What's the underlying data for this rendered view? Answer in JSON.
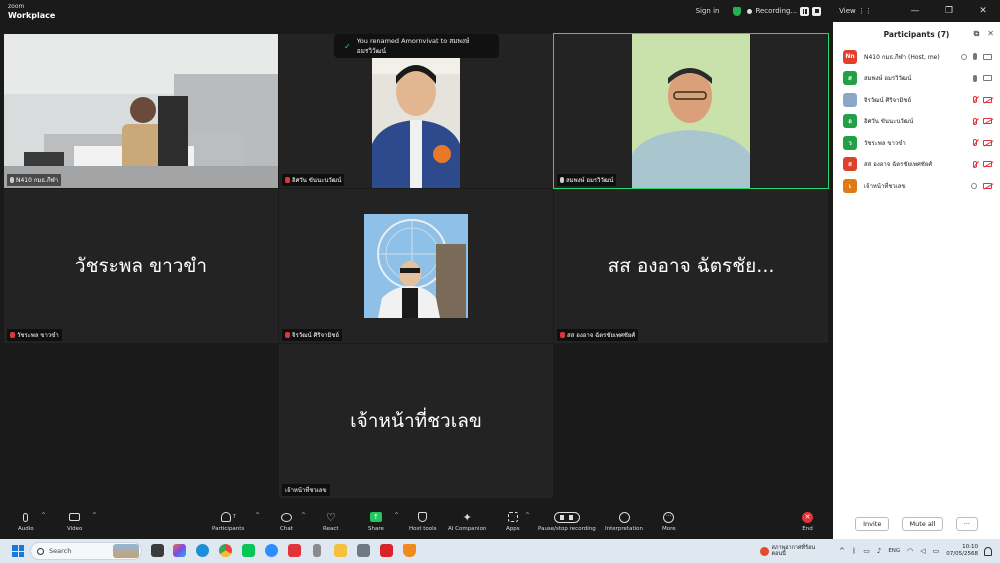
{
  "app": {
    "logo_line1": "zoom",
    "logo_line2": "Workplace",
    "sign_in": "Sign in",
    "recording": "Recording...",
    "view": "View"
  },
  "toast": {
    "text": "You renamed Amornvivat to สมพงษ์ อมรวิวัฒน์"
  },
  "tiles": [
    {
      "label": "N410 กมธ.กีฬา",
      "mic_off": false,
      "camera": "room"
    },
    {
      "label": "อิศวัน ขันนะนวัฒน์",
      "mic_off": true,
      "camera": "person"
    },
    {
      "label": "สมพงษ์ อมรวิวัฒน์",
      "mic_off": false,
      "camera": "elder",
      "speaking": true
    },
    {
      "label": "วัชระพล ขาวขำ",
      "mic_off": true,
      "display_name": "วัชระพล ขาวขำ"
    },
    {
      "label": "จิรวัฒน์ ศิริจามิชย์",
      "mic_off": true,
      "camera": "ferris"
    },
    {
      "label": "สส องอาจ ฉัตรชัยเพศชัยศ์",
      "mic_off": true,
      "display_name": "สส องอาจ ฉัตรชัย..."
    },
    {
      "label": "เจ้าหน้าที่ชวเลข",
      "mic_off": false,
      "display_name": "เจ้าหน้าที่ชวเลข"
    }
  ],
  "panel": {
    "title": "Participants (7)",
    "participants": [
      {
        "initials": "Nn",
        "color": "#e0402a",
        "name": "N410 กมธ.กีฬา (Host, me)",
        "mic": "on",
        "cam": "on",
        "rec": true
      },
      {
        "initials": "ส",
        "color": "#22a045",
        "name": "สมพงษ์ อมรวิวัฒน์",
        "mic": "on",
        "cam": "on",
        "rec": false
      },
      {
        "initials": "",
        "color": "#8aa7c8",
        "name": "จิรวัฒน์ ศิริจามิชย์",
        "mic": "off",
        "cam": "off",
        "rec": false
      },
      {
        "initials": "อ",
        "color": "#22a045",
        "name": "อิศวัน ขันนะนวัฒน์",
        "mic": "off",
        "cam": "off",
        "rec": false
      },
      {
        "initials": "ว",
        "color": "#22a045",
        "name": "วัชระพล ขาวขำ",
        "mic": "off",
        "cam": "off",
        "rec": false
      },
      {
        "initials": "ส",
        "color": "#e0402a",
        "name": "สส องอาจ ฉัตรชัยเพศชัยศ์",
        "mic": "off",
        "cam": "off",
        "rec": false
      },
      {
        "initials": "เ",
        "color": "#e07a16",
        "name": "เจ้าหน้าที่ชวเลข",
        "mic": "none",
        "cam": "off",
        "rec": true
      }
    ],
    "invite": "Invite",
    "mute_all": "Mute all",
    "more": "···"
  },
  "toolbar": {
    "audio": "Audio",
    "video": "Video",
    "participants": "Participants",
    "participants_count": "7",
    "chat": "Chat",
    "react": "React",
    "share": "Share",
    "host_tools": "Host tools",
    "ai_companion": "AI Companion",
    "apps": "Apps",
    "pause_stop": "Pause/stop recording",
    "interpretation": "Interpretation",
    "more": "More",
    "end": "End"
  },
  "taskbar": {
    "search": "Search",
    "weather_line1": "สภาพอากาศที่ร้อน",
    "weather_line2": "ตอนนี้",
    "lang": "ENG",
    "time": "10:10",
    "date": "07/05/2568"
  },
  "colors": {
    "speaking_outline": "#23d96b",
    "mic_off": "#e0343a",
    "share_green": "#23c55e",
    "end_red": "#e0343a"
  }
}
